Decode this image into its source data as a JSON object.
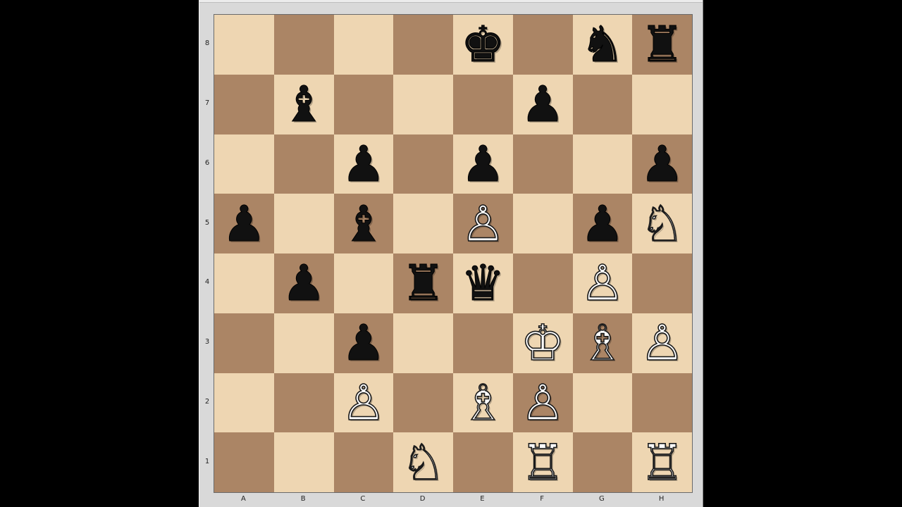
{
  "board": {
    "files": [
      "A",
      "B",
      "C",
      "D",
      "E",
      "F",
      "G",
      "H"
    ],
    "ranks": [
      "8",
      "7",
      "6",
      "5",
      "4",
      "3",
      "2",
      "1"
    ],
    "colors": {
      "light": "#eed6b2",
      "dark": "#ab8565"
    },
    "pieces": [
      {
        "square": "e8",
        "color": "b",
        "type": "king",
        "glyph": "♚",
        "icon": "black-king-icon"
      },
      {
        "square": "g8",
        "color": "b",
        "type": "knight",
        "glyph": "♞",
        "icon": "black-knight-icon"
      },
      {
        "square": "h8",
        "color": "b",
        "type": "rook",
        "glyph": "♜",
        "icon": "black-rook-icon"
      },
      {
        "square": "b7",
        "color": "b",
        "type": "bishop",
        "glyph": "♝",
        "icon": "black-bishop-icon"
      },
      {
        "square": "f7",
        "color": "b",
        "type": "pawn",
        "glyph": "♟",
        "icon": "black-pawn-icon"
      },
      {
        "square": "c6",
        "color": "b",
        "type": "pawn",
        "glyph": "♟",
        "icon": "black-pawn-icon"
      },
      {
        "square": "e6",
        "color": "b",
        "type": "pawn",
        "glyph": "♟",
        "icon": "black-pawn-icon"
      },
      {
        "square": "h6",
        "color": "b",
        "type": "pawn",
        "glyph": "♟",
        "icon": "black-pawn-icon"
      },
      {
        "square": "a5",
        "color": "b",
        "type": "pawn",
        "glyph": "♟",
        "icon": "black-pawn-icon"
      },
      {
        "square": "c5",
        "color": "b",
        "type": "bishop",
        "glyph": "♝",
        "icon": "black-bishop-icon"
      },
      {
        "square": "e5",
        "color": "w",
        "type": "pawn",
        "glyph": "♙",
        "icon": "white-pawn-icon"
      },
      {
        "square": "g5",
        "color": "b",
        "type": "pawn",
        "glyph": "♟",
        "icon": "black-pawn-icon"
      },
      {
        "square": "h5",
        "color": "w",
        "type": "knight",
        "glyph": "♘",
        "icon": "white-knight-icon"
      },
      {
        "square": "b4",
        "color": "b",
        "type": "pawn",
        "glyph": "♟",
        "icon": "black-pawn-icon"
      },
      {
        "square": "d4",
        "color": "b",
        "type": "rook",
        "glyph": "♜",
        "icon": "black-rook-icon"
      },
      {
        "square": "e4",
        "color": "b",
        "type": "queen",
        "glyph": "♛",
        "icon": "black-queen-icon"
      },
      {
        "square": "g4",
        "color": "w",
        "type": "pawn",
        "glyph": "♙",
        "icon": "white-pawn-icon"
      },
      {
        "square": "c3",
        "color": "b",
        "type": "pawn",
        "glyph": "♟",
        "icon": "black-pawn-icon"
      },
      {
        "square": "f3",
        "color": "w",
        "type": "king",
        "glyph": "♔",
        "icon": "white-king-icon"
      },
      {
        "square": "g3",
        "color": "w",
        "type": "bishop",
        "glyph": "♗",
        "icon": "white-bishop-icon"
      },
      {
        "square": "h3",
        "color": "w",
        "type": "pawn",
        "glyph": "♙",
        "icon": "white-pawn-icon"
      },
      {
        "square": "c2",
        "color": "w",
        "type": "pawn",
        "glyph": "♙",
        "icon": "white-pawn-icon"
      },
      {
        "square": "e2",
        "color": "w",
        "type": "bishop",
        "glyph": "♗",
        "icon": "white-bishop-icon"
      },
      {
        "square": "f2",
        "color": "w",
        "type": "pawn",
        "glyph": "♙",
        "icon": "white-pawn-icon"
      },
      {
        "square": "d1",
        "color": "w",
        "type": "knight",
        "glyph": "♘",
        "icon": "white-knight-icon"
      },
      {
        "square": "f1",
        "color": "w",
        "type": "rook",
        "glyph": "♖",
        "icon": "white-rook-icon"
      },
      {
        "square": "h1",
        "color": "w",
        "type": "rook",
        "glyph": "♖",
        "icon": "white-rook-icon"
      }
    ]
  }
}
